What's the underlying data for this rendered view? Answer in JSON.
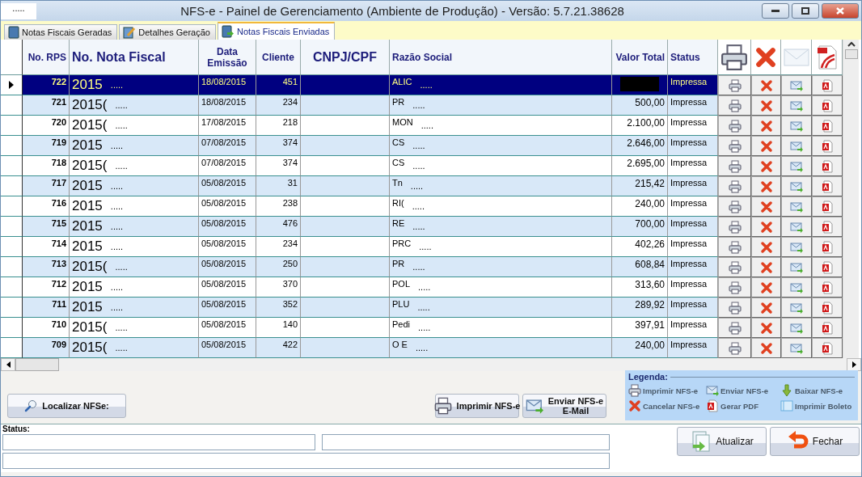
{
  "window": {
    "app_label": ".....",
    "title": "NFS-e - Painel de Gerenciamento (Ambiente de Produção) -  Versão: 5.7.21.38628"
  },
  "tabs": [
    {
      "label": "Notas Fiscais Geradas",
      "kind": "book",
      "selected": false
    },
    {
      "label": "Detalhes Geração",
      "kind": "edit",
      "selected": false
    },
    {
      "label": "Notas Fiscais Enviadas",
      "kind": "send",
      "selected": true
    }
  ],
  "table": {
    "columns": [
      "No. RPS",
      "No. Nota Fiscal",
      "Data Emissão",
      "Cliente",
      "CNPJ/CPF",
      "Razão Social",
      "Valor Total",
      "Status"
    ],
    "action_columns": [
      {
        "kind": "print"
      },
      {
        "kind": "cancel"
      },
      {
        "kind": "email"
      },
      {
        "kind": "pdf"
      }
    ],
    "rows": [
      {
        "rps": "722",
        "nota": "2015",
        "nota_mask": ".....",
        "data": "18/08/2015",
        "cliente": "451",
        "razao": "ALIC",
        "razao_mask": ".....",
        "valor_redacted": true,
        "status": "Impressa",
        "selected": true
      },
      {
        "rps": "721",
        "nota": "2015(",
        "nota_mask": ".....",
        "data": "18/08/2015",
        "cliente": "234",
        "razao": "PR",
        "razao_mask": ".....",
        "valor": "500,00",
        "status": "Impressa",
        "selected": false
      },
      {
        "rps": "720",
        "nota": "2015(",
        "nota_mask": ".....",
        "data": "17/08/2015",
        "cliente": "218",
        "razao": "MON",
        "razao_mask": ".....",
        "valor": "2.100,00",
        "status": "Impressa",
        "selected": false
      },
      {
        "rps": "719",
        "nota": "2015",
        "nota_mask": ".....",
        "data": "07/08/2015",
        "cliente": "374",
        "razao": "CS",
        "razao_mask": ".....",
        "valor": "2.646,00",
        "status": "Impressa",
        "selected": false
      },
      {
        "rps": "718",
        "nota": "2015(",
        "nota_mask": ".....",
        "data": "07/08/2015",
        "cliente": "374",
        "razao": "CS",
        "razao_mask": ".....",
        "valor": "2.695,00",
        "status": "Impressa",
        "selected": false
      },
      {
        "rps": "717",
        "nota": "2015",
        "nota_mask": ".....",
        "data": "05/08/2015",
        "cliente": "31",
        "razao": "Tn",
        "razao_mask": ".....",
        "valor": "215,42",
        "status": "Impressa",
        "selected": false
      },
      {
        "rps": "716",
        "nota": "2015",
        "nota_mask": ".....",
        "data": "05/08/2015",
        "cliente": "238",
        "razao": "RI(",
        "razao_mask": ".....",
        "valor": "240,00",
        "status": "Impressa",
        "selected": false
      },
      {
        "rps": "715",
        "nota": "2015",
        "nota_mask": ".....",
        "data": "05/08/2015",
        "cliente": "476",
        "razao": "RE",
        "razao_mask": ".....",
        "valor": "700,00",
        "status": "Impressa",
        "selected": false
      },
      {
        "rps": "714",
        "nota": "2015",
        "nota_mask": ".....",
        "data": "05/08/2015",
        "cliente": "234",
        "razao": "PRC",
        "razao_mask": ".....",
        "valor": "402,26",
        "status": "Impressa",
        "selected": false
      },
      {
        "rps": "713",
        "nota": "2015(",
        "nota_mask": ".....",
        "data": "05/08/2015",
        "cliente": "250",
        "razao": "PR",
        "razao_mask": ".....",
        "valor": "608,84",
        "status": "Impressa",
        "selected": false
      },
      {
        "rps": "712",
        "nota": "2015",
        "nota_mask": ".....",
        "data": "05/08/2015",
        "cliente": "370",
        "razao": "POL",
        "razao_mask": ".....",
        "valor": "313,60",
        "status": "Impressa",
        "selected": false
      },
      {
        "rps": "711",
        "nota": "2015",
        "nota_mask": ".....",
        "data": "05/08/2015",
        "cliente": "352",
        "razao": "PLU",
        "razao_mask": ".....",
        "valor": "289,92",
        "status": "Impressa",
        "selected": false
      },
      {
        "rps": "710",
        "nota": "2015(",
        "nota_mask": ".....",
        "data": "05/08/2015",
        "cliente": "140",
        "razao": "Pedi",
        "razao_mask": ".....",
        "valor": "397,91",
        "status": "Impressa",
        "selected": false
      },
      {
        "rps": "709",
        "nota": "2015(",
        "nota_mask": ".....",
        "data": "05/08/2015",
        "cliente": "422",
        "razao": "O E",
        "razao_mask": ".....",
        "valor": "240,00",
        "status": "Impressa",
        "selected": false
      }
    ]
  },
  "actions": [
    {
      "label": "Localizar NFSe:",
      "kind": "search"
    },
    {
      "label": "Imprimir NFS-e",
      "kind": "print"
    },
    {
      "label": "Enviar NFS-e\nE-Mail",
      "kind": "email"
    }
  ],
  "legend": {
    "title": "Legenda:",
    "items": [
      {
        "label": "Imprimir NFS-e",
        "kind": "print"
      },
      {
        "label": "Enviar NFS-e",
        "kind": "email"
      },
      {
        "label": "Baixar NFS-e",
        "kind": "download"
      },
      {
        "label": "Cancelar NFS-e",
        "kind": "cancel"
      },
      {
        "label": "Gerar PDF",
        "kind": "pdf"
      },
      {
        "label": "Imprimir Boleto",
        "kind": "boleto"
      }
    ]
  },
  "status": {
    "label": "Status:"
  },
  "footer_buttons": [
    {
      "label": "Atualizar",
      "kind": "refresh"
    },
    {
      "label": "Fechar",
      "kind": "close"
    }
  ]
}
